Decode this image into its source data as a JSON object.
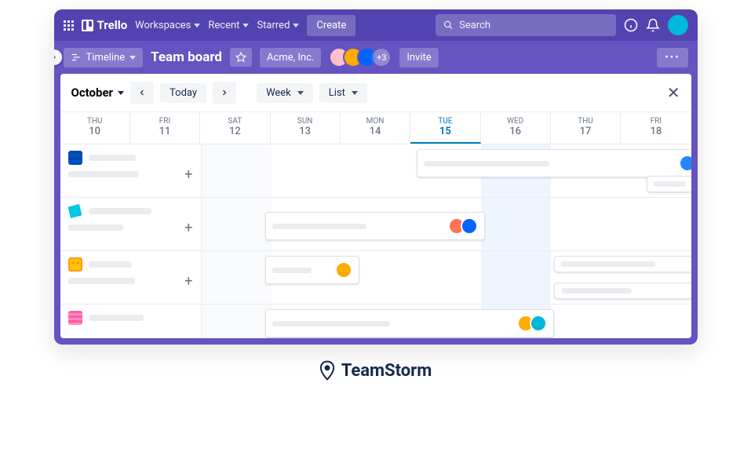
{
  "brand": "Trello",
  "nav": {
    "workspaces": "Workspaces",
    "recent": "Recent",
    "starred": "Starred",
    "create": "Create"
  },
  "search": {
    "placeholder": "Search"
  },
  "board": {
    "view": "Timeline",
    "title": "Team board",
    "workspace": "Acme, Inc.",
    "invite": "Invite",
    "more_members": "+3"
  },
  "toolbar": {
    "month": "October",
    "today": "Today",
    "range": "Week",
    "mode": "List"
  },
  "days": [
    {
      "dow": "THU",
      "num": "10"
    },
    {
      "dow": "FRI",
      "num": "11"
    },
    {
      "dow": "SAT",
      "num": "12"
    },
    {
      "dow": "SUN",
      "num": "13"
    },
    {
      "dow": "MON",
      "num": "14"
    },
    {
      "dow": "TUE",
      "num": "15",
      "today": true
    },
    {
      "dow": "WED",
      "num": "16"
    },
    {
      "dow": "THU",
      "num": "17"
    },
    {
      "dow": "FRI",
      "num": "18"
    }
  ],
  "footer": "TeamStorm"
}
